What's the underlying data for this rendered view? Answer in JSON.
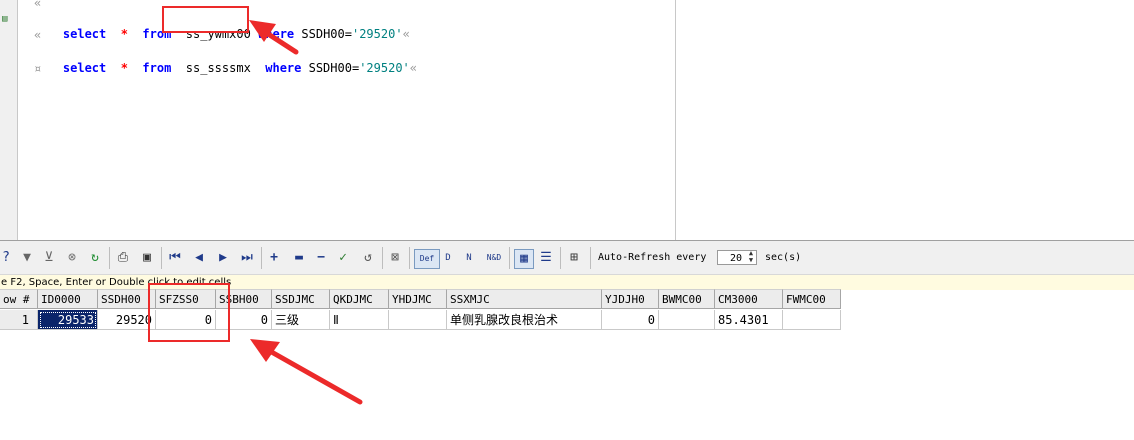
{
  "editor": {
    "pilcrow_top": "«",
    "line1": {
      "kw1": "select",
      "star": "*",
      "kw2": "from",
      "table": "ss_ywmx00",
      "kw3": "where",
      "col": "SSDH00",
      "eq": "=",
      "val": "'29520'",
      "eol": "«"
    },
    "pilcrow_mid": "«",
    "line2": {
      "kw1": "select",
      "star": "*",
      "kw2": "from",
      "table": "ss_ssssmx",
      "kw3": "where",
      "col": "SSDH00",
      "eq": "=",
      "val": "'29520'",
      "eol": "«"
    },
    "end_mark": "¤"
  },
  "toolbar": {
    "icons": [
      "help-icon",
      "filter-icon",
      "filter-clear-icon",
      "cancel-icon",
      "refresh-icon",
      "print-icon",
      "save-icon",
      "first-record-icon",
      "prev-record-icon",
      "next-record-icon",
      "last-record-icon",
      "insert-icon",
      "edit-icon",
      "delete-icon",
      "post-icon",
      "cancel-edit-icon",
      "clear-icon",
      "def-icon",
      "d-icon",
      "n-icon",
      "nd-icon",
      "grid-view-icon",
      "form-view-icon",
      "export-icon"
    ],
    "def_label": "Def",
    "d_label": "D",
    "n_label": "N",
    "nd_label": "N&D",
    "auto_refresh_label": "Auto-Refresh every",
    "auto_refresh_value": "20",
    "auto_refresh_unit": "sec(s)"
  },
  "hint": "e F2, Space, Enter or Double click to edit cells",
  "grid": {
    "columns": [
      "ow #",
      "ID0000",
      "SSDH00",
      "SFZSS0",
      "SSBH00",
      "SSDJMC",
      "QKDJMC",
      "YHDJMC",
      "SSXMJC",
      "YJDJH0",
      "BWMC00",
      "CM3000",
      "FWMC00"
    ],
    "row": [
      "1",
      "29533",
      "29520",
      "0",
      "0",
      "三级",
      "Ⅱ",
      "",
      "单侧乳腺改良根治术",
      "0",
      "",
      "85.4301",
      ""
    ]
  },
  "colors": {
    "keyword": "#0000ff",
    "star": "#ff0000",
    "string": "#008080",
    "annotation": "#ec2a2a",
    "selection": "#0a246a"
  }
}
